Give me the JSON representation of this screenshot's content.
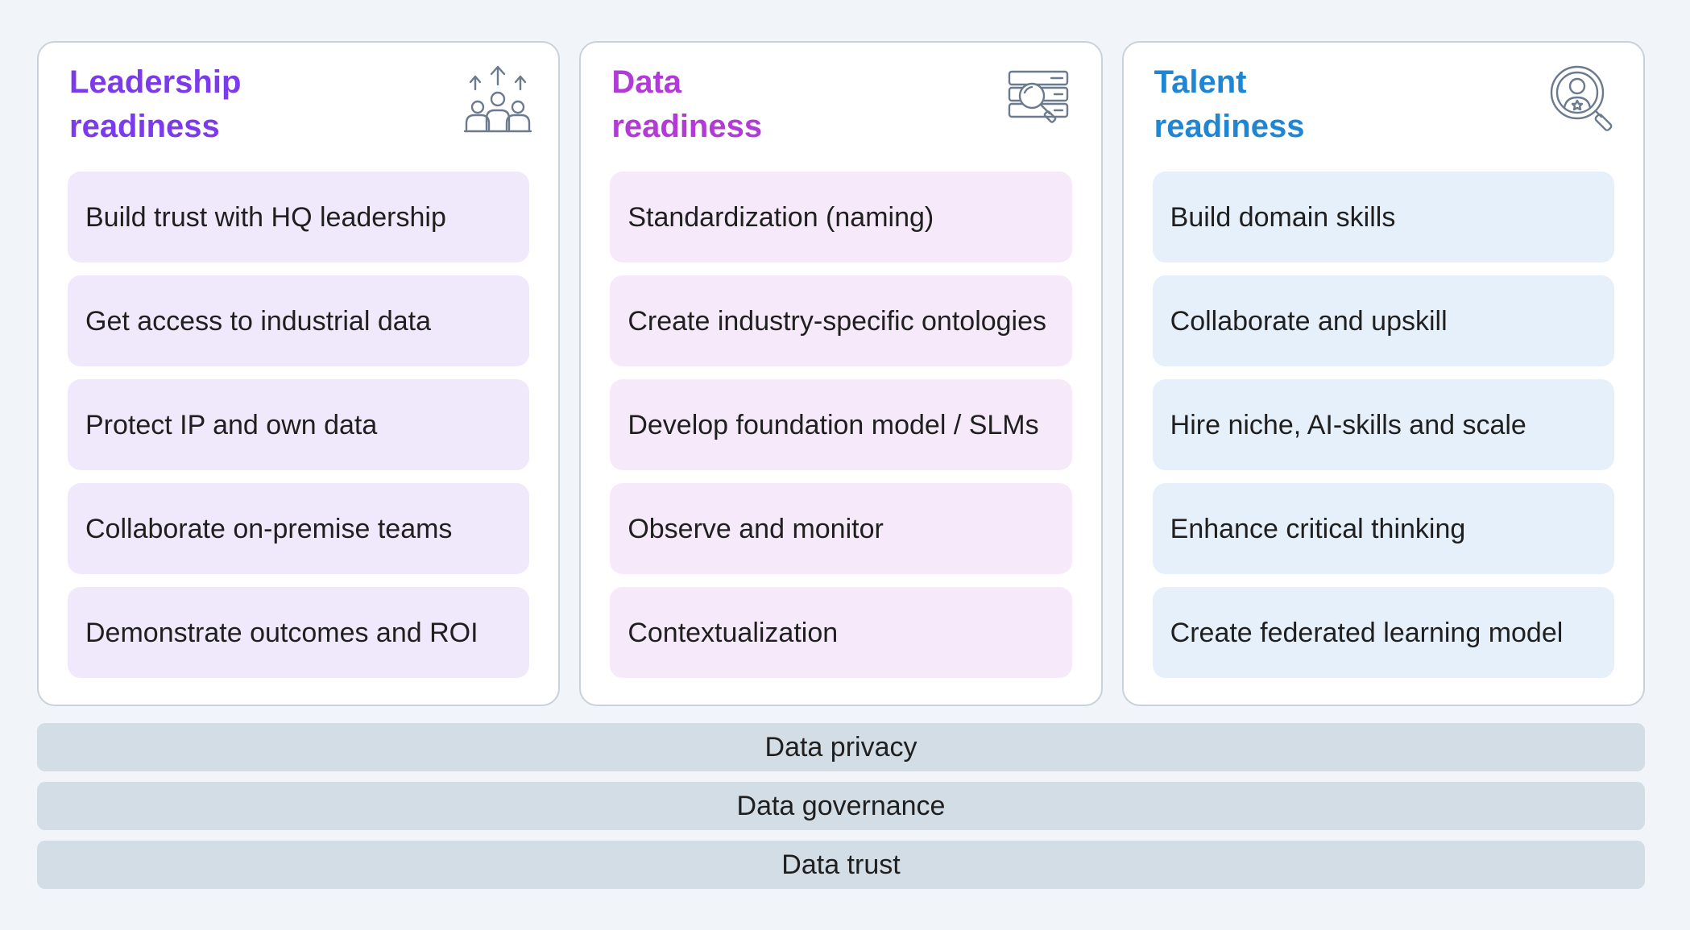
{
  "columns": [
    {
      "title": "Leadership\nreadiness",
      "title_color": "#7c3aed",
      "item_bg": "#efe9fb",
      "icon": "team-growth-icon",
      "items": [
        "Build trust with HQ leadership",
        "Get access to industrial data",
        "Protect IP and own data",
        "Collaborate on-premise teams",
        "Demonstrate outcomes and ROI"
      ]
    },
    {
      "title": "Data\nreadiness",
      "title_color": "#b23ad6",
      "item_bg": "#f6e9fa",
      "icon": "data-search-icon",
      "items": [
        "Standardization (naming)",
        "Create industry-specific ontologies",
        "Develop foundation model / SLMs",
        "Observe and monitor",
        "Contextualization"
      ]
    },
    {
      "title": "Talent\nreadiness",
      "title_color": "#1f86d4",
      "item_bg": "#e6f0fa",
      "icon": "talent-search-icon",
      "items": [
        "Build domain skills",
        "Collaborate and upskill",
        "Hire niche, AI-skills and scale",
        "Enhance critical thinking",
        "Create federated learning model"
      ]
    }
  ],
  "foundation": [
    "Data privacy",
    "Data governance",
    "Data trust"
  ],
  "colors": {
    "background": "#f1f5f9",
    "bar": "#d3dde5",
    "card_border": "#c9d2dc",
    "icon_stroke": "#6b7a8c"
  }
}
